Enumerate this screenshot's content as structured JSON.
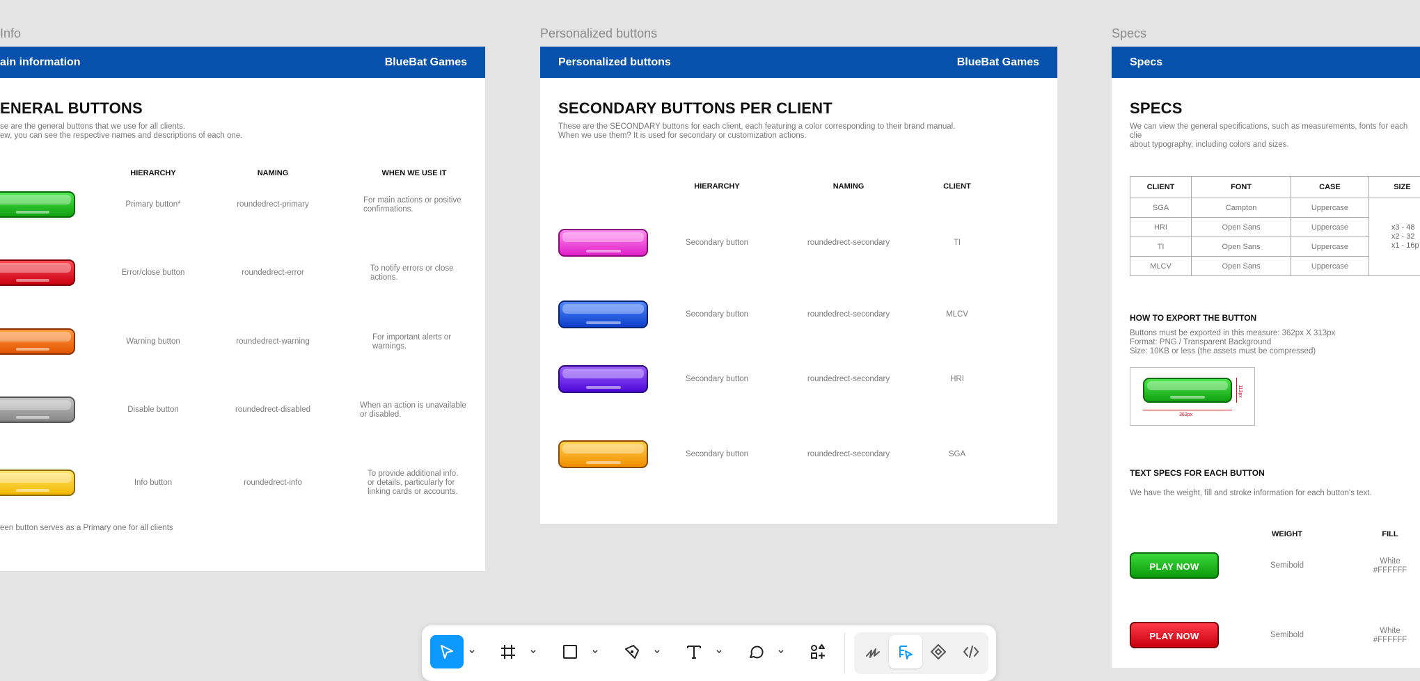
{
  "canvas": {
    "frames": [
      {
        "label": "Info",
        "label_visible": "Info"
      },
      {
        "label": "Personalized buttons"
      },
      {
        "label": "Specs"
      }
    ]
  },
  "frame1": {
    "header_title": "ain information",
    "header_brand": "BlueBat Games",
    "title": "ENERAL BUTTONS",
    "description": "se are the general buttons that we use for all clients.\new, you can see the respective names and descriptions of each one.",
    "columns": [
      "HIERARCHY",
      "NAMING",
      "WHEN WE USE IT"
    ],
    "rows": [
      {
        "color": "green",
        "hierarchy": "Primary button*",
        "naming": "roundedrect-primary",
        "when": "For main actions or positive\nconfirmations."
      },
      {
        "color": "red",
        "hierarchy": "Error/close button",
        "naming": "roundedrect-error",
        "when": "To notify errors or close\nactions."
      },
      {
        "color": "orange",
        "hierarchy": "Warning button",
        "naming": "roundedrect-warning",
        "when": "For important alerts or\nwarnings."
      },
      {
        "color": "gray",
        "hierarchy": "Disable button",
        "naming": "roundedrect-disabled",
        "when": "When an action is unavailable\nor disabled."
      },
      {
        "color": "yellow",
        "hierarchy": "Info button",
        "naming": "roundedrect-info",
        "when": "To provide additional info.\nor details, particularly for\nlinking cards or accounts."
      }
    ],
    "footnote": "een button serves as a Primary one for all clients"
  },
  "frame2": {
    "label": "Personalized buttons",
    "header_title": "Personalized buttons",
    "header_brand": "BlueBat Games",
    "title": "SECONDARY BUTTONS PER CLIENT",
    "description": "These are the SECONDARY buttons for each client, each featuring a color corresponding to their brand manual.\nWhen we use them? It is used for secondary or customization actions.",
    "columns": [
      "HIERARCHY",
      "NAMING",
      "CLIENT"
    ],
    "rows": [
      {
        "color": "pink",
        "hierarchy": "Secondary button",
        "naming": "roundedrect-secondary",
        "client": "TI"
      },
      {
        "color": "blue",
        "hierarchy": "Secondary button",
        "naming": "roundedrect-secondary",
        "client": "MLCV"
      },
      {
        "color": "purple",
        "hierarchy": "Secondary button",
        "naming": "roundedrect-secondary",
        "client": "HRI"
      },
      {
        "color": "amber",
        "hierarchy": "Secondary button",
        "naming": "roundedrect-secondary",
        "client": "SGA"
      }
    ]
  },
  "frame3": {
    "label": "Specs",
    "header_title": "Specs",
    "title": "SPECS",
    "description": "We can view the general specifications, such as measurements, fonts for each clie\nabout typography, including colors and sizes.",
    "table": {
      "headers": [
        "CLIENT",
        "FONT",
        "CASE",
        "SIZE"
      ],
      "rows": [
        [
          "SGA",
          "Campton",
          "Uppercase"
        ],
        [
          "HRI",
          "Open Sans",
          "Uppercase"
        ],
        [
          "TI",
          "Open Sans",
          "Uppercase"
        ],
        [
          "MLCV",
          "Open Sans",
          "Uppercase"
        ]
      ],
      "size_values": [
        "x3 - 48",
        "x2 - 32",
        "x1 - 16p"
      ]
    },
    "export_title": "HOW TO EXPORT THE BUTTON",
    "export_text": "Buttons must be exported in this measure: 362px X 313px\nFormat: PNG / Transparent Background\nSize: 10KB or less (the assets must be compressed)",
    "export_width_label": "362px",
    "export_height_label": "113px",
    "text_specs_title": "TEXT SPECS FOR EACH BUTTON",
    "text_specs_desc": "We have the weight, fill and stroke information for each button's text.",
    "text_specs_columns": [
      "WEIGHT",
      "FILL"
    ],
    "text_specs_rows": [
      {
        "color": "green",
        "label": "PLAY NOW",
        "weight": "Semibold",
        "fill": "White\n#FFFFFF"
      },
      {
        "color": "red",
        "label": "PLAY NOW",
        "weight": "Semibold",
        "fill": "White\n#FFFFFF"
      }
    ]
  },
  "colors": {
    "header_blue": "#0551ab",
    "green": "#1dbf1d",
    "red": "#e0091b",
    "orange": "#ff6a00",
    "gray": "#9a9a9a",
    "yellow": "#ffd21a",
    "pink": "#f23fd6",
    "blue": "#1a57e6",
    "purple": "#6a1bf2",
    "amber": "#ffa600",
    "selection_blue": "#0d99ff"
  },
  "toolbar": {
    "tools": [
      "move-tool",
      "frame-tool",
      "shape-tool",
      "pen-tool",
      "text-tool",
      "comment-tool",
      "actions-tool"
    ],
    "mode_tools": [
      "draw-mode",
      "design-mode",
      "prototype-mode",
      "dev-mode"
    ],
    "selected": "move-tool",
    "active_mode": "design-mode"
  }
}
